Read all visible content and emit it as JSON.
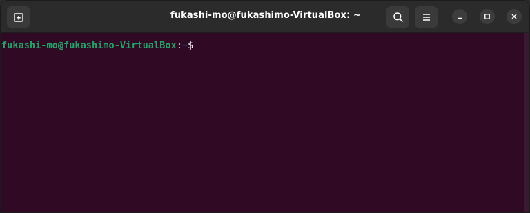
{
  "window": {
    "title": "fukashi-mo@fukashimo-VirtualBox: ~"
  },
  "header": {
    "new_tab_icon": "new-tab-icon",
    "search_icon": "search-icon",
    "menu_icon": "hamburger-menu-icon",
    "minimize_icon": "minimize-icon",
    "maximize_icon": "maximize-icon",
    "close_icon": "close-icon"
  },
  "terminal": {
    "prompt_user_host": "fukashi-mo@fukashimo-VirtualBox",
    "prompt_separator": ":",
    "prompt_path": "~",
    "prompt_symbol": "$",
    "colors": {
      "background": "#300a24",
      "user_host": "#26a269",
      "path": "#12488b",
      "text": "#ffffff"
    }
  }
}
